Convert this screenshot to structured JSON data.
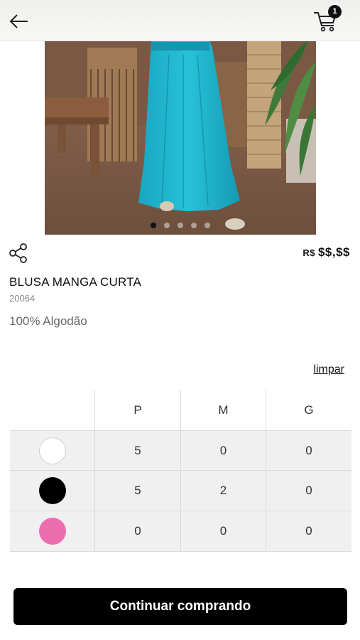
{
  "header": {
    "back_icon": "arrow-left-icon",
    "cart_icon": "shopping-cart-icon",
    "cart_count": "1"
  },
  "carousel": {
    "active_index": 0,
    "dot_count": 5
  },
  "product": {
    "share_icon": "share-icon",
    "price_currency": "R$",
    "price_value": "$$,$$",
    "name": "BLUSA MANGA CURTA",
    "code": "20064",
    "material": "100% Algodão"
  },
  "grid_section": {
    "clear_label": "limpar",
    "sizes": [
      "P",
      "M",
      "G"
    ],
    "rows": [
      {
        "color_name": "white",
        "color_hex": "#ffffff",
        "quantities": [
          "5",
          "0",
          "0"
        ]
      },
      {
        "color_name": "black",
        "color_hex": "#000000",
        "quantities": [
          "5",
          "2",
          "0"
        ]
      },
      {
        "color_name": "pink",
        "color_hex": "#ec6db0",
        "quantities": [
          "0",
          "0",
          "0"
        ]
      }
    ]
  },
  "footer": {
    "continue_label": "Continuar comprando"
  },
  "colors": {
    "accent": "#000000",
    "button_text": "#ffffff"
  }
}
